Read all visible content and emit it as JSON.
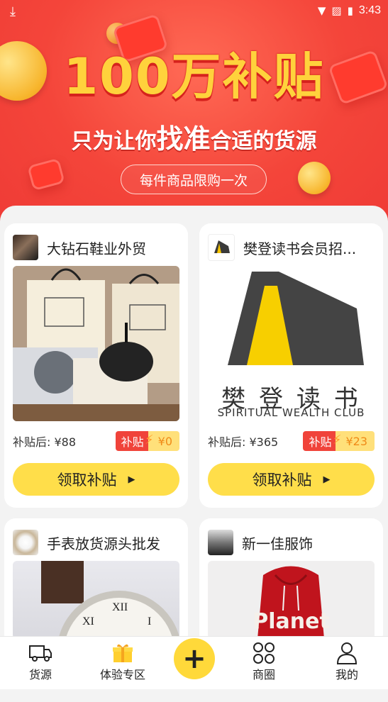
{
  "status_bar": {
    "time": "3:43"
  },
  "banner": {
    "title": "100万补贴",
    "subtitle_pre": "只为让你",
    "subtitle_emph": "找准",
    "subtitle_post": "合适的货源",
    "pill": "每件商品限购一次"
  },
  "cards": [
    {
      "name": "大钻石鞋业外贸",
      "price": "补贴后: ¥88",
      "subsidy_label": "补贴",
      "subsidy_value": "¥0",
      "claim": "领取补贴"
    },
    {
      "name": "樊登读书会员招...",
      "price": "补贴后: ¥365",
      "subsidy_label": "补贴",
      "subsidy_value": "¥23",
      "claim": "领取补贴",
      "logo_cn": "樊 登 读 书",
      "logo_en": "SPIRITUAL WEALTH CLUB"
    },
    {
      "name": "手表放货源头批发"
    },
    {
      "name": "新一佳服饰",
      "product_text": "Planet"
    }
  ],
  "nav": [
    {
      "label": "货源"
    },
    {
      "label": "体验专区"
    },
    {
      "label": "商圈"
    },
    {
      "label": "我的"
    }
  ],
  "colors": {
    "accent": "#ffde4a",
    "banner": "#f4453a",
    "subsidy_red": "#f0433a"
  }
}
